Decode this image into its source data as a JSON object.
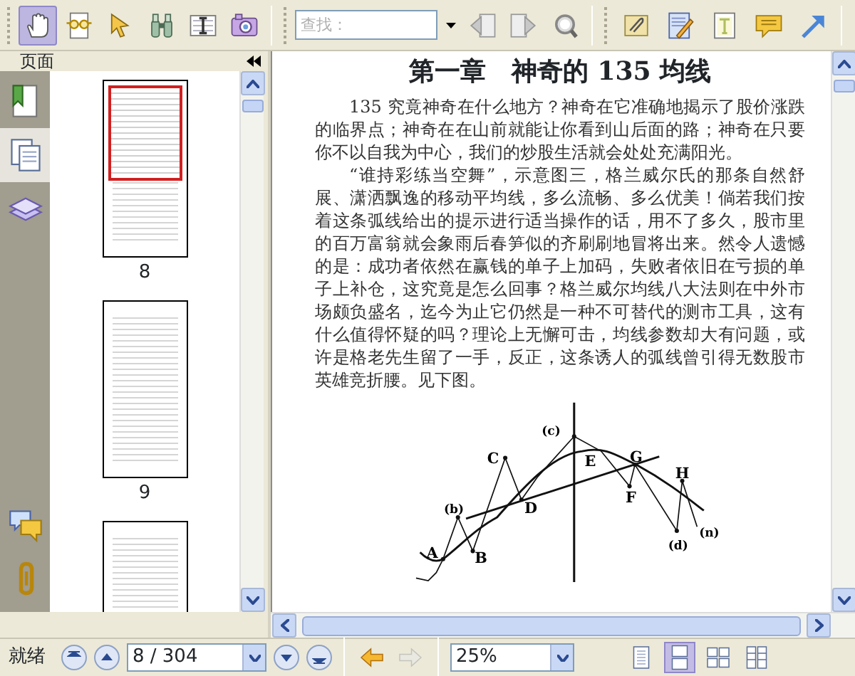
{
  "toolbar": {
    "tools": [
      {
        "kind": "hand",
        "selected": true
      },
      {
        "kind": "reader",
        "selected": false
      },
      {
        "kind": "select",
        "selected": false
      },
      {
        "kind": "binoculars",
        "selected": false
      },
      {
        "kind": "text-select",
        "selected": false
      },
      {
        "kind": "camera",
        "selected": false
      }
    ],
    "search": {
      "placeholder": "查找："
    },
    "search_tools": [
      {
        "kind": "find-previous"
      },
      {
        "kind": "find-next"
      },
      {
        "kind": "search"
      }
    ],
    "annotation_tools": [
      {
        "kind": "attach"
      },
      {
        "kind": "note"
      },
      {
        "kind": "text-box"
      },
      {
        "kind": "comment"
      },
      {
        "kind": "arrow"
      }
    ]
  },
  "sidebar": {
    "title": "页面",
    "panels": [
      {
        "kind": "bookmarks",
        "selected": false
      },
      {
        "kind": "pages",
        "selected": true
      },
      {
        "kind": "layers",
        "selected": false
      }
    ],
    "bottom_panels": [
      {
        "kind": "comments"
      },
      {
        "kind": "attachments"
      }
    ],
    "thumbnails": [
      {
        "label": "8",
        "current": true
      },
      {
        "label": "9",
        "current": false
      },
      {
        "current": false
      }
    ]
  },
  "document": {
    "heading": "第一章　神奇的 135 均线",
    "paragraphs": [
      "135 究竟神奇在什么地方？神奇在它准确地揭示了股价涨跌的临界点；神奇在在山前就能让你看到山后面的路；神奇在只要你不以自我为中心，我们的炒股生活就会处处充满阳光。",
      "“谁持彩练当空舞”，示意图三，格兰威尔氏的那条自然舒展、潇洒飘逸的移动平均线，多么流畅、多么优美！倘若我们按着这条弧线给出的提示进行适当操作的话，用不了多久，股市里的百万富翁就会象雨后春笋似的齐刷刷地冒将出来。然令人遗憾的是：成功者依然在赢钱的单子上加码，失败者依旧在亏损的单子上补仓，这究竟是怎么回事？格兰威尔均线八大法则在中外市场颇负盛名，迄今为止它仍然是一种不可替代的测市工具，这有什么值得怀疑的吗？理论上无懈可击，均线参数却大有问题，或许是格老先生留了一手，反正，这条诱人的弧线曾引得无数股市英雄竞折腰。见下图。"
    ],
    "figure_labels": [
      "A",
      "(b)",
      "B",
      "C",
      "D",
      "(c)",
      "E",
      "F",
      "G",
      "H",
      "(d)",
      "(n)"
    ]
  },
  "status_bar": {
    "text": "就绪",
    "page": "8 / 304",
    "zoom": "25%",
    "history": [
      {
        "kind": "back",
        "disabled": false
      },
      {
        "kind": "forward",
        "disabled": true
      }
    ],
    "view_modes": [
      {
        "kind": "single",
        "selected": false
      },
      {
        "kind": "continuous",
        "selected": true
      },
      {
        "kind": "facing",
        "selected": false
      },
      {
        "kind": "continuous-facing",
        "selected": false
      }
    ]
  }
}
